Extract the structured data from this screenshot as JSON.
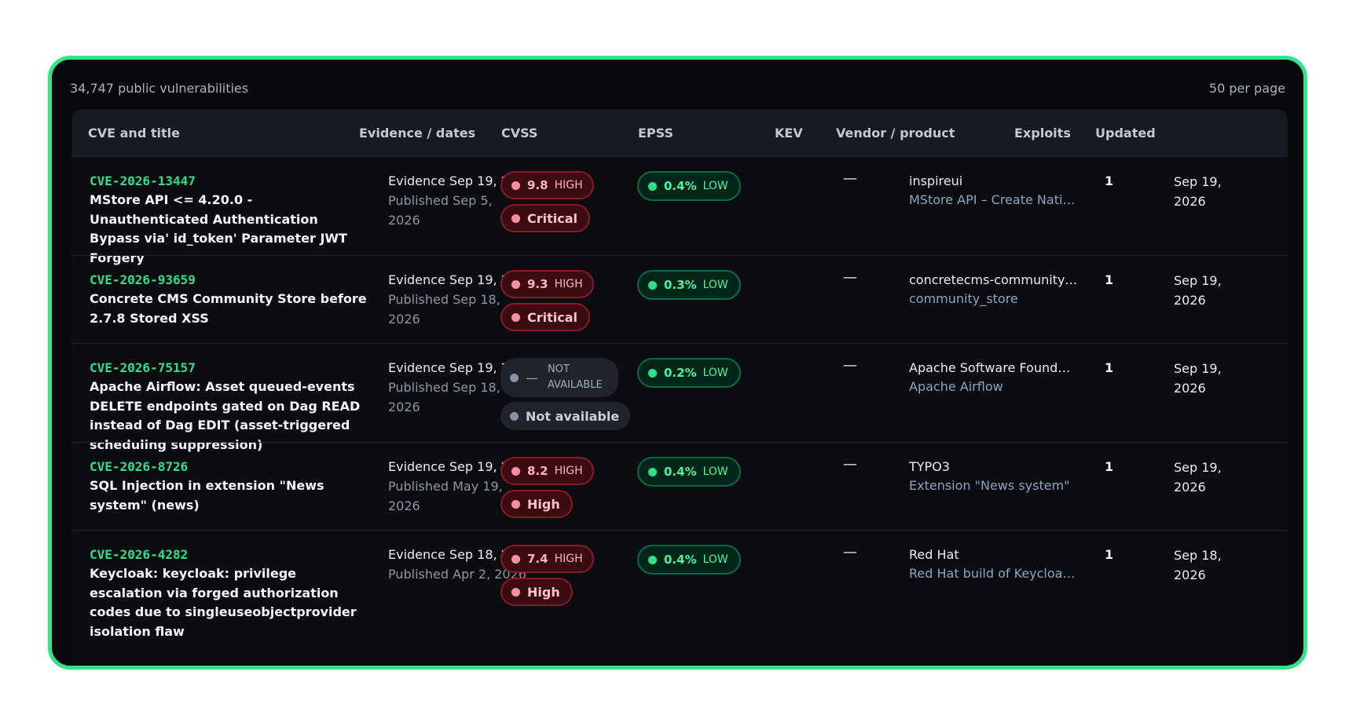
{
  "summary": {
    "count_text": "34,747 public vulnerabilities",
    "per_page": "50 per page"
  },
  "columns": [
    "CVE and title",
    "Evidence / dates",
    "CVSS",
    "EPSS",
    "KEV",
    "Vendor / product",
    "Exploits",
    "Updated"
  ],
  "colors": {
    "accent": "#2ee58b",
    "cve": "#2fe08b",
    "critical": "#ff8f9b",
    "epss_low": "#2fe08b"
  },
  "rows": [
    {
      "cve": "CVE-2026-13447",
      "title": "MStore API <= 4.20.0 - Unauthenticated Authentication Bypass via' id_token' Parameter JWT Forgery",
      "evidence": "Evidence Sep 19, 2026",
      "published": "Published Sep 5, 2026",
      "cvss_score": "9.8",
      "cvss_label": "HIGH",
      "severity": "Critical",
      "epss_value": "0.4%",
      "epss_label": "LOW",
      "kev": "—",
      "vendor": "inspireui",
      "product": "MStore API – Create Nativ…",
      "exploits": "1",
      "updated": "Sep 19, 2026"
    },
    {
      "cve": "CVE-2026-93659",
      "title": "Concrete CMS Community Store before 2.7.8 Stored XSS",
      "evidence": "Evidence Sep 19, 2026",
      "published": "Published Sep 18, 2026",
      "cvss_score": "9.3",
      "cvss_label": "HIGH",
      "severity": "Critical",
      "epss_value": "0.3%",
      "epss_label": "LOW",
      "kev": "—",
      "vendor": "concretecms-community-s…",
      "product": "community_store",
      "exploits": "1",
      "updated": "Sep 19, 2026"
    },
    {
      "cve": "CVE-2026-75157",
      "title": "Apache Airflow: Asset queued-events DELETE endpoints gated on Dag READ instead of Dag EDIT (asset-triggered scheduling suppression)",
      "evidence": "Evidence Sep 19, 2026",
      "published": "Published Sep 18, 2026",
      "cvss_score": "—",
      "cvss_label": "NOT AVAILABLE",
      "severity": "Not available",
      "epss_value": "0.2%",
      "epss_label": "LOW",
      "kev": "—",
      "vendor": "Apache Software Foundat…",
      "product": "Apache Airflow",
      "exploits": "1",
      "updated": "Sep 19, 2026"
    },
    {
      "cve": "CVE-2026-8726",
      "title": "SQL Injection in extension \"News system\" (news)",
      "evidence": "Evidence Sep 19, 2026",
      "published": "Published May 19, 2026",
      "cvss_score": "8.2",
      "cvss_label": "HIGH",
      "severity": "High",
      "epss_value": "0.4%",
      "epss_label": "LOW",
      "kev": "—",
      "vendor": "TYPO3",
      "product": "Extension \"News system\"",
      "exploits": "1",
      "updated": "Sep 19, 2026"
    },
    {
      "cve": "CVE-2026-4282",
      "title": "Keycloak: keycloak: privilege escalation via forged authorization codes due to singleuseobjectprovider isolation flaw",
      "evidence": "Evidence Sep 18, 2026",
      "published": "Published Apr 2, 2026",
      "cvss_score": "7.4",
      "cvss_label": "HIGH",
      "severity": "High",
      "epss_value": "0.4%",
      "epss_label": "LOW",
      "kev": "—",
      "vendor": "Red Hat",
      "product": "Red Hat build of Keycloak …",
      "exploits": "1",
      "updated": "Sep 18, 2026"
    }
  ]
}
